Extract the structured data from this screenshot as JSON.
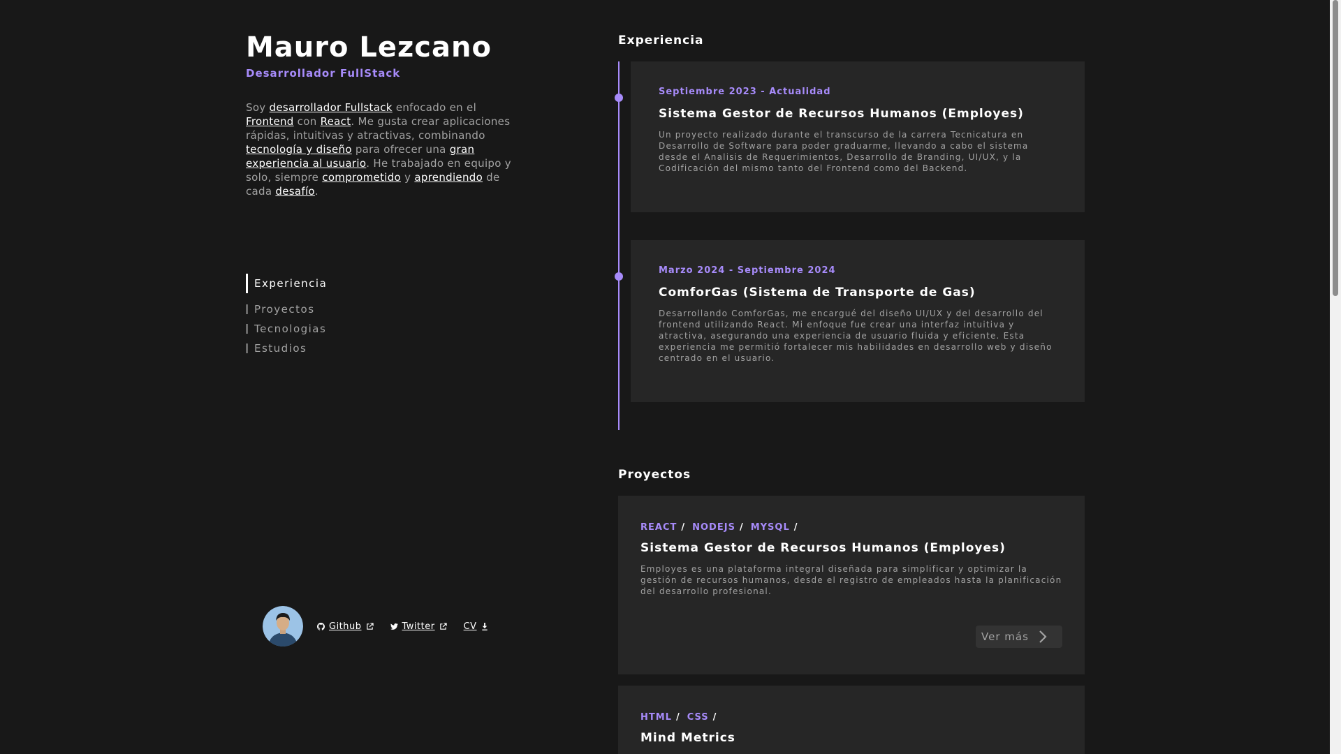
{
  "profile": {
    "name": "Mauro Lezcano",
    "role": "Desarrollador FullStack",
    "bio": [
      {
        "t": "Soy ",
        "hl": false
      },
      {
        "t": "desarrollador Fullstack",
        "hl": true
      },
      {
        "t": " enfocado en el ",
        "hl": false
      },
      {
        "t": "Frontend",
        "hl": true
      },
      {
        "t": " con ",
        "hl": false
      },
      {
        "t": "React",
        "hl": true
      },
      {
        "t": ". Me gusta crear aplicaciones rápidas, intuitivas y atractivas, combinando ",
        "hl": false
      },
      {
        "t": "tecnología y diseño",
        "hl": true
      },
      {
        "t": " para ofrecer una ",
        "hl": false
      },
      {
        "t": "gran experiencia al usuario",
        "hl": true
      },
      {
        "t": ". He trabajado en equipo y solo, siempre ",
        "hl": false
      },
      {
        "t": "comprometido",
        "hl": true
      },
      {
        "t": " y ",
        "hl": false
      },
      {
        "t": "aprendiendo",
        "hl": true
      },
      {
        "t": " de cada ",
        "hl": false
      },
      {
        "t": "desafío",
        "hl": true
      },
      {
        "t": ".",
        "hl": false
      }
    ]
  },
  "nav": {
    "items": [
      {
        "label": "Experiencia",
        "active": true
      },
      {
        "label": "Proyectos",
        "active": false
      },
      {
        "label": "Tecnologias",
        "active": false
      },
      {
        "label": "Estudios",
        "active": false
      }
    ]
  },
  "socials": {
    "github": "Github",
    "twitter": "Twitter",
    "cv": "CV"
  },
  "experience": {
    "title": "Experiencia",
    "items": [
      {
        "date": "Septiembre 2023 - Actualidad",
        "title": "Sistema Gestor de Recursos Humanos (Employes)",
        "description": "Un proyecto realizado durante el transcurso de la carrera Tecnicatura en Desarrollo de Software para poder graduarme, llevando a cabo el sistema desde el Analisis de Requerimientos, Desarrollo de Branding, UI/UX, y la Codificación del mismo tanto del Frontend como del Backend."
      },
      {
        "date": "Marzo 2024 - Septiembre 2024",
        "title": "ComforGas (Sistema de Transporte de Gas)",
        "description": "Desarrollando ComforGas, me encargué del diseño UI/UX y del desarrollo del frontend utilizando React. Mi enfoque fue crear una interfaz intuitiva y atractiva, asegurando una experiencia de usuario fluida y eficiente. Esta experiencia me permitió fortalecer mis habilidades en desarrollo web y diseño centrado en el usuario."
      }
    ]
  },
  "projects": {
    "title": "Proyectos",
    "more_label": "Ver más",
    "items": [
      {
        "tags": [
          "REACT",
          "NODEJS",
          "MYSQL"
        ],
        "title": "Sistema Gestor de Recursos Humanos (Employes)",
        "description": "Employes es una plataforma integral diseñada para simplificar y optimizar la gestión de recursos humanos, desde el registro de empleados hasta la planificación del desarrollo profesional."
      },
      {
        "tags": [
          "HTML",
          "CSS"
        ],
        "title": "Mind Metrics",
        "description": ""
      }
    ]
  },
  "colors": {
    "background": "#181818",
    "card": "#262626",
    "accent": "#a78bfa",
    "text": "#ffffff",
    "muted": "#a3a3a3"
  }
}
